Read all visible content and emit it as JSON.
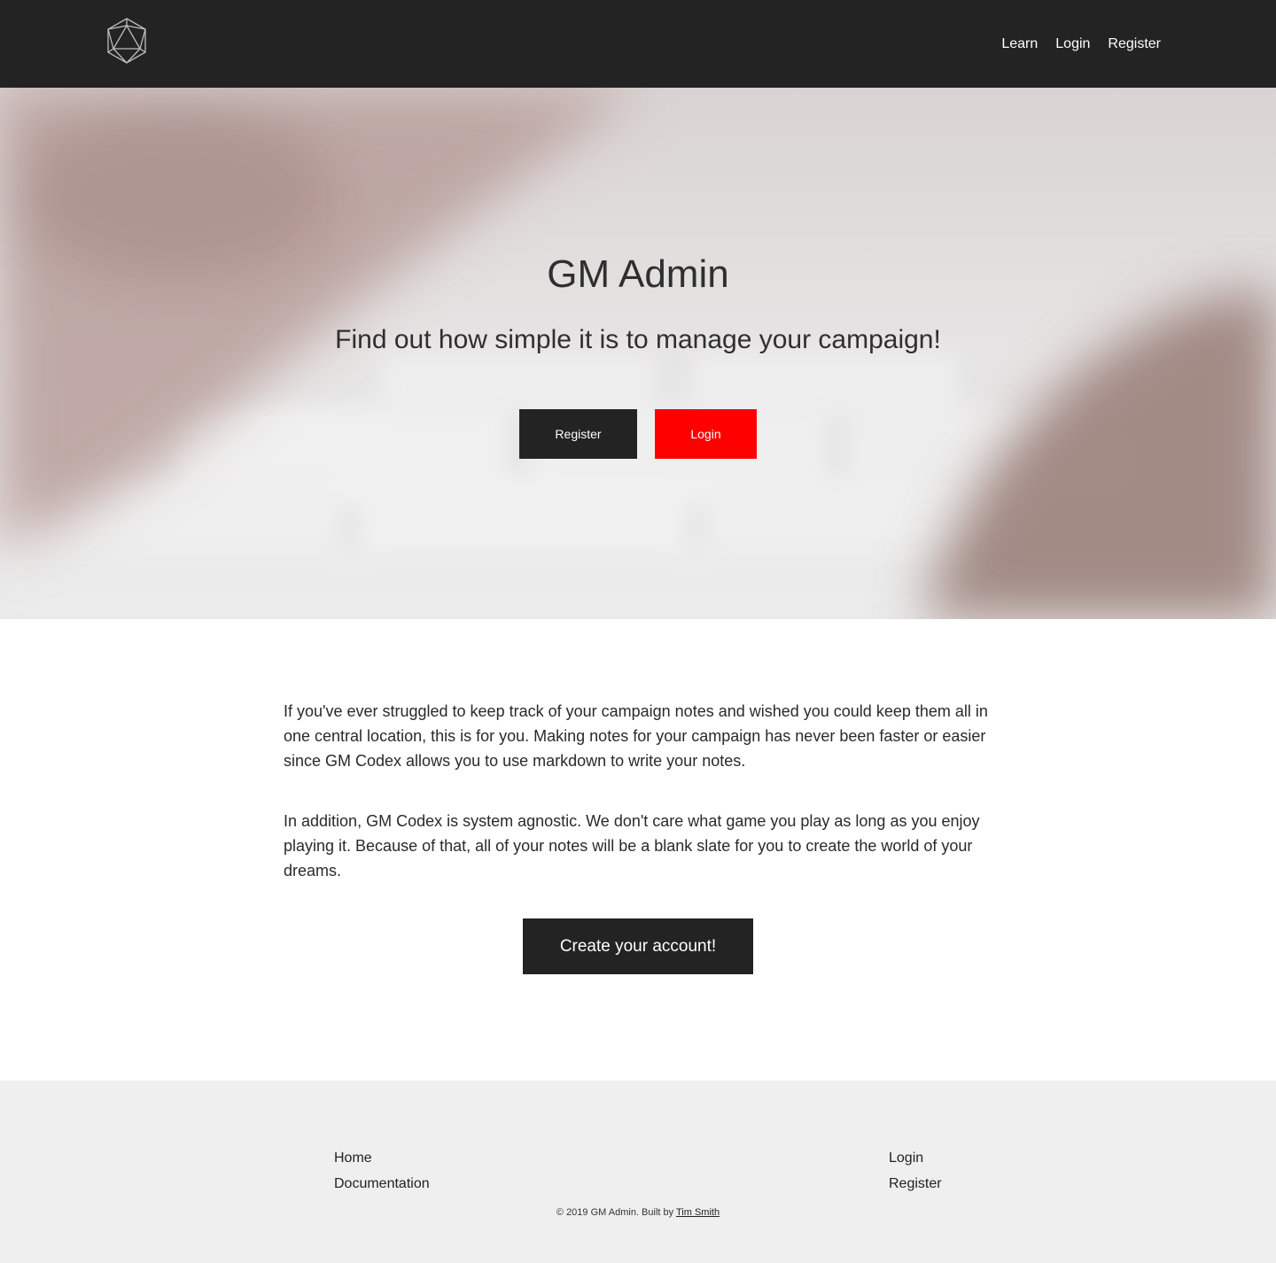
{
  "nav": {
    "learn": "Learn",
    "login": "Login",
    "register": "Register"
  },
  "hero": {
    "title": "GM Admin",
    "subtitle": "Find out how simple it is to manage your campaign!",
    "register_btn": "Register",
    "login_btn": "Login"
  },
  "main": {
    "para1": "If you've ever struggled to keep track of your campaign notes and wished you could keep them all in one central location, this is for you. Making notes for your campaign has never been faster or easier since GM Codex allows you to use markdown to write your notes.",
    "para2": "In addition, GM Codex is system agnostic. We don't care what game you play as long as you enjoy playing it. Because of that, all of your notes will be a blank slate for you to create the world of your dreams.",
    "cta": "Create your account!"
  },
  "footer": {
    "left_links": [
      "Home",
      "Documentation"
    ],
    "right_links": [
      "Login",
      "Register"
    ],
    "copyright_prefix": "© 2019 GM Admin. Built by",
    "author": "Tim Smith"
  },
  "colors": {
    "dark": "#232323",
    "accent_red": "#ff0000",
    "footer_bg": "#efefef"
  },
  "icons": {
    "logo": "d20-icosahedron-logo"
  }
}
